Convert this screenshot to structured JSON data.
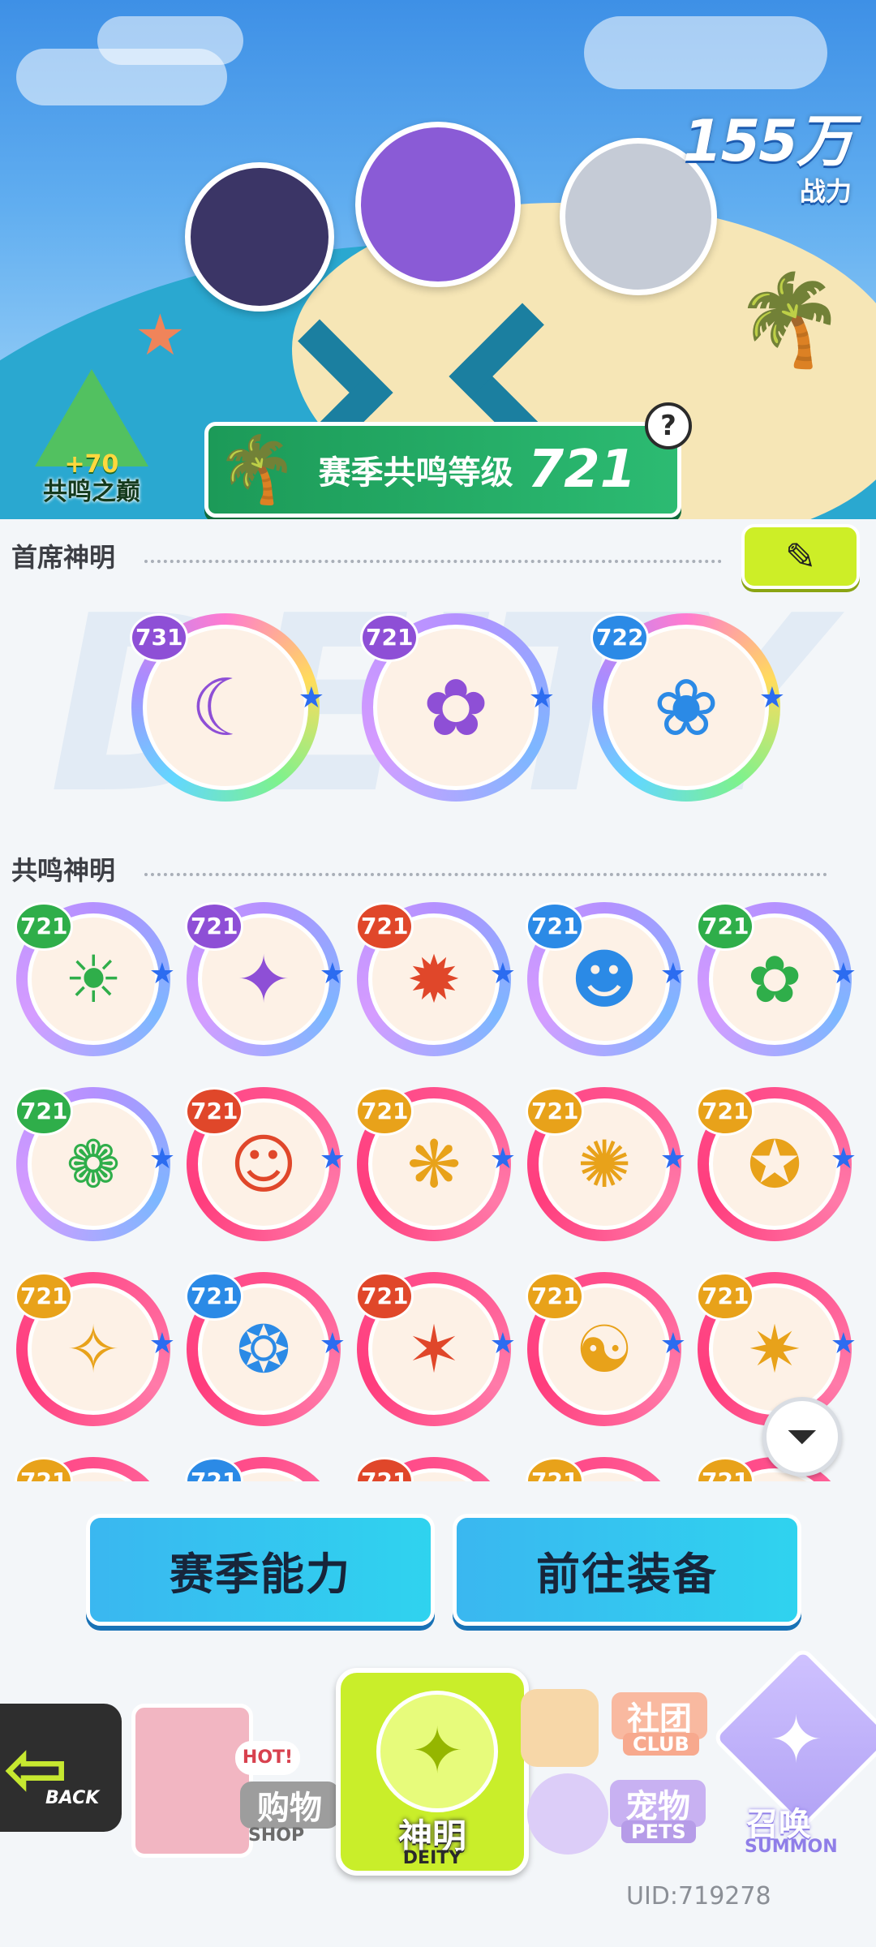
{
  "header": {
    "power_value": "155万",
    "power_label": "战力"
  },
  "peak_badge": {
    "bonus": "+70",
    "label": "共鸣之巅"
  },
  "season_level": {
    "label": "赛季共鸣等级",
    "value": "721",
    "help_icon": "question-icon"
  },
  "chief_section": {
    "title": "首席神明",
    "edit_icon": "pencil-icon",
    "watermark": "DEITY",
    "deities": [
      {
        "level": "731",
        "face": "☾",
        "frame": "rainbow",
        "badge_color": "#8e4fd6"
      },
      {
        "level": "721",
        "face": "✿",
        "frame": "purple",
        "badge_color": "#8e4fd6"
      },
      {
        "level": "722",
        "face": "❀",
        "frame": "rainbow",
        "badge_color": "#2b8ae6"
      }
    ]
  },
  "resonance_section": {
    "title": "共鸣神明",
    "grid": [
      {
        "level": "721",
        "face": "☀",
        "frame": "purple",
        "badge_color": "#2fae4a"
      },
      {
        "level": "721",
        "face": "✦",
        "frame": "purple",
        "badge_color": "#8e4fd6"
      },
      {
        "level": "721",
        "face": "✹",
        "frame": "purple",
        "badge_color": "#e0472a"
      },
      {
        "level": "721",
        "face": "☻",
        "frame": "purple",
        "badge_color": "#2b8ae6"
      },
      {
        "level": "721",
        "face": "✿",
        "frame": "purple",
        "badge_color": "#2fae4a"
      },
      {
        "level": "721",
        "face": "❁",
        "frame": "purple",
        "badge_color": "#2fae4a"
      },
      {
        "level": "721",
        "face": "☺",
        "frame": "pink",
        "badge_color": "#e0472a"
      },
      {
        "level": "721",
        "face": "❋",
        "frame": "pink",
        "badge_color": "#e8a21a"
      },
      {
        "level": "721",
        "face": "✺",
        "frame": "pink",
        "badge_color": "#e8a21a"
      },
      {
        "level": "721",
        "face": "✪",
        "frame": "pink",
        "badge_color": "#e8a21a"
      },
      {
        "level": "721",
        "face": "✧",
        "frame": "pink",
        "badge_color": "#e8a21a"
      },
      {
        "level": "721",
        "face": "❂",
        "frame": "pink",
        "badge_color": "#2b8ae6"
      },
      {
        "level": "721",
        "face": "✶",
        "frame": "pink",
        "badge_color": "#e0472a"
      },
      {
        "level": "721",
        "face": "☯",
        "frame": "pink",
        "badge_color": "#e8a21a"
      },
      {
        "level": "721",
        "face": "✷",
        "frame": "pink",
        "badge_color": "#e8a21a"
      }
    ],
    "filter_icon": "filter-icon"
  },
  "actions": {
    "season_ability": "赛季能力",
    "go_equipment": "前往装备"
  },
  "bottom_nav": {
    "back": {
      "icon": "back-arrow-icon",
      "en": "BACK"
    },
    "shop": {
      "hot": "HOT!",
      "cn": "购物",
      "en": "SHOP"
    },
    "deity": {
      "cn": "神明",
      "en": "DEITY"
    },
    "club": {
      "cn": "社团",
      "en": "CLUB"
    },
    "pets": {
      "cn": "宠物",
      "en": "PETS"
    },
    "summon": {
      "cn": "召唤",
      "en": "SUMMON"
    }
  },
  "uid": "UID:719278"
}
